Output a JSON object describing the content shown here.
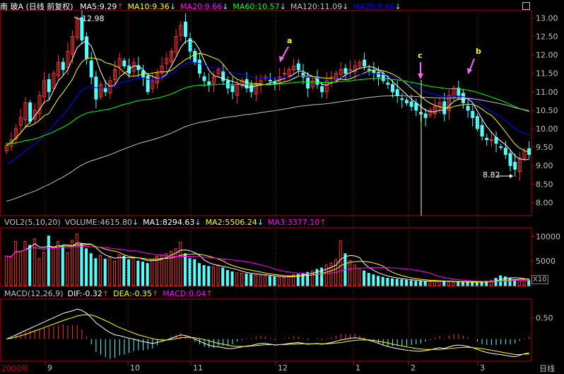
{
  "header": {
    "stock_title": "南 玻A (日线 前复权)",
    "ma_items": [
      {
        "label": "MA5:9.29",
        "color": "#ffffff",
        "arrow": "↑"
      },
      {
        "label": "MA10:9.36",
        "color": "#ffff00",
        "arrow": "↓"
      },
      {
        "label": "MA20:9.66",
        "color": "#ff00ff",
        "arrow": "↓"
      },
      {
        "label": "MA60:10.57",
        "color": "#00ff00",
        "arrow": "↓"
      },
      {
        "label": "MA120:11.09",
        "color": "#c0c0c0",
        "arrow": "↓"
      },
      {
        "label": "MA20:9.66",
        "color": "#0000ff",
        "arrow": "↓"
      }
    ]
  },
  "volume_header": {
    "items": [
      {
        "label": "VOL2(5,10,20)",
        "color": "#c0c0c0",
        "arrow": ""
      },
      {
        "label": "VOLUME:4615.80",
        "color": "#c0c0c0",
        "arrow": "↓"
      },
      {
        "label": "MA1:8294.63",
        "color": "#ffffff",
        "arrow": "↓"
      },
      {
        "label": "MA2:5506.24",
        "color": "#ffff00",
        "arrow": "↓"
      },
      {
        "label": "MA3:3377.10",
        "color": "#ff00ff",
        "arrow": "↑"
      }
    ]
  },
  "macd_header": {
    "items": [
      {
        "label": "MACD(12,26,9)",
        "color": "#c0c0c0",
        "arrow": ""
      },
      {
        "label": "DIF:-0.32",
        "color": "#ffffff",
        "arrow": "↑"
      },
      {
        "label": "DEA:-0.35",
        "color": "#ffff00",
        "arrow": "↑"
      },
      {
        "label": "MACD:0.04",
        "color": "#ff00ff",
        "arrow": "↑"
      }
    ]
  },
  "annotations": {
    "high_label": "12.98",
    "low_label": "8.82",
    "mark_a": "a",
    "mark_b": "b",
    "mark_c": "c",
    "vol_scale": "X10"
  },
  "footer": {
    "year_label": "2000年",
    "period_label": "日线",
    "months": [
      "9",
      "10",
      "11",
      "12",
      "1",
      "2",
      "3"
    ]
  },
  "colors": {
    "up": "#ff3232",
    "down": "#54ffff",
    "axis": "#b00000",
    "ma5": "#ffffff",
    "ma10": "#ffff00",
    "ma20": "#0000ff",
    "ma60": "#00ff00",
    "ma120": "#c0c0c0"
  },
  "chart_data": [
    {
      "type": "candlestick",
      "yticks": [
        8.0,
        8.5,
        9.0,
        9.5,
        10.0,
        10.5,
        11.0,
        11.5,
        12.0,
        12.5,
        13.0
      ],
      "ylim": [
        7.7,
        13.2
      ],
      "close": [
        9.55,
        9.7,
        10.0,
        10.3,
        10.7,
        10.2,
        10.5,
        10.9,
        11.3,
        11.0,
        11.5,
        11.8,
        11.6,
        12.1,
        12.5,
        12.98,
        12.4,
        11.9,
        11.4,
        10.8,
        11.2,
        11.0,
        11.3,
        11.6,
        11.9,
        11.7,
        11.5,
        11.8,
        11.6,
        11.4,
        11.0,
        11.3,
        11.5,
        11.7,
        11.9,
        12.1,
        12.5,
        12.8,
        12.5,
        12.1,
        11.8,
        11.5,
        11.3,
        11.2,
        11.4,
        11.6,
        11.3,
        11.1,
        11.0,
        11.2,
        11.3,
        11.1,
        11.0,
        11.2,
        11.3,
        11.4,
        11.3,
        11.2,
        11.4,
        11.5,
        11.6,
        11.7,
        11.6,
        11.4,
        11.1,
        11.3,
        11.2,
        11.0,
        11.3,
        11.4,
        11.5,
        11.6,
        11.5,
        11.6,
        11.7,
        11.8,
        11.7,
        11.6,
        11.5,
        11.4,
        11.3,
        11.2,
        11.0,
        10.9,
        10.8,
        10.7,
        10.6,
        10.5,
        10.4,
        10.3,
        10.5,
        10.6,
        10.7,
        10.4,
        10.9,
        11.1,
        10.9,
        10.7,
        10.5,
        10.3,
        10.0,
        9.8,
        9.7,
        9.7,
        9.6,
        9.5,
        9.3,
        9.0,
        8.9,
        9.2,
        9.4,
        9.3
      ],
      "high_value": 12.98,
      "low_value": 8.82
    },
    {
      "type": "bar",
      "title": "VOLUME",
      "yticks": [
        5000,
        10000
      ],
      "ylim": [
        0,
        11500
      ],
      "values": [
        6000,
        5800,
        9000,
        7000,
        9000,
        8200,
        9500,
        5500,
        6800,
        10100,
        7500,
        9000,
        8000,
        6700,
        9200,
        10500,
        8500,
        7500,
        6500,
        5500,
        6200,
        5400,
        5800,
        5000,
        6300,
        6000,
        5300,
        5700,
        5000,
        4800,
        4500,
        5400,
        6000,
        6200,
        6500,
        7000,
        7500,
        8800,
        6500,
        5500,
        5300,
        4500,
        4100,
        3900,
        3800,
        4200,
        3600,
        3100,
        2800,
        2600,
        2500,
        2400,
        2300,
        2200,
        2100,
        2000,
        1900,
        1800,
        1600,
        1700,
        2000,
        2200,
        2300,
        2500,
        2700,
        3000,
        3300,
        3600,
        4200,
        4600,
        5300,
        9100,
        6500,
        5100,
        4200,
        3500,
        3000,
        2500,
        2200,
        1900,
        1700,
        1500,
        1400,
        1300,
        1200,
        1100,
        1000,
        900,
        850,
        800,
        900,
        1000,
        900,
        850,
        800,
        700,
        750,
        800,
        700,
        650,
        700,
        750,
        900,
        1100,
        1500,
        2000,
        1800,
        1500,
        1200,
        1300,
        1200,
        1100
      ],
      "scale_label": "X10"
    },
    {
      "type": "line",
      "title": "MACD",
      "yticks": [
        0.5
      ],
      "ylim": [
        -0.5,
        0.9
      ],
      "series": [
        {
          "name": "DIF",
          "values": [
            0.0,
            0.05,
            0.1,
            0.15,
            0.2,
            0.25,
            0.3,
            0.35,
            0.4,
            0.45,
            0.5,
            0.55,
            0.6,
            0.63,
            0.66,
            0.7,
            0.67,
            0.6,
            0.5,
            0.38,
            0.3,
            0.22,
            0.15,
            0.1,
            0.08,
            0.05,
            0.02,
            0.0,
            -0.03,
            -0.06,
            -0.08,
            -0.1,
            -0.08,
            -0.05,
            -0.02,
            0.02,
            0.06,
            0.1,
            0.08,
            0.05,
            0.0,
            -0.05,
            -0.1,
            -0.14,
            -0.17,
            -0.18,
            -0.2,
            -0.22,
            -0.22,
            -0.2,
            -0.18,
            -0.16,
            -0.15,
            -0.12,
            -0.1,
            -0.1,
            -0.12,
            -0.14,
            -0.13,
            -0.12,
            -0.1,
            -0.09,
            -0.08,
            -0.1,
            -0.12,
            -0.11,
            -0.1,
            -0.12,
            -0.1,
            -0.08,
            -0.05,
            -0.02,
            0.0,
            0.02,
            0.03,
            0.02,
            0.0,
            -0.03,
            -0.06,
            -0.1,
            -0.14,
            -0.17,
            -0.2,
            -0.22,
            -0.24,
            -0.26,
            -0.27,
            -0.28,
            -0.28,
            -0.27,
            -0.25,
            -0.22,
            -0.2,
            -0.22,
            -0.18,
            -0.15,
            -0.14,
            -0.15,
            -0.17,
            -0.2,
            -0.24,
            -0.28,
            -0.31,
            -0.33,
            -0.35,
            -0.36,
            -0.38,
            -0.4,
            -0.41,
            -0.38,
            -0.34,
            -0.32
          ]
        },
        {
          "name": "DEA",
          "values": [
            0.0,
            0.02,
            0.05,
            0.08,
            0.11,
            0.15,
            0.19,
            0.23,
            0.27,
            0.31,
            0.35,
            0.39,
            0.43,
            0.47,
            0.5,
            0.54,
            0.56,
            0.57,
            0.56,
            0.53,
            0.48,
            0.43,
            0.38,
            0.32,
            0.27,
            0.23,
            0.18,
            0.14,
            0.1,
            0.07,
            0.04,
            0.01,
            -0.01,
            -0.02,
            -0.02,
            -0.01,
            0.01,
            0.03,
            0.04,
            0.04,
            0.03,
            0.01,
            -0.01,
            -0.04,
            -0.07,
            -0.1,
            -0.12,
            -0.14,
            -0.16,
            -0.17,
            -0.17,
            -0.17,
            -0.16,
            -0.15,
            -0.14,
            -0.13,
            -0.13,
            -0.13,
            -0.13,
            -0.13,
            -0.12,
            -0.12,
            -0.11,
            -0.11,
            -0.11,
            -0.11,
            -0.11,
            -0.11,
            -0.11,
            -0.1,
            -0.09,
            -0.08,
            -0.06,
            -0.04,
            -0.03,
            -0.02,
            -0.02,
            -0.02,
            -0.03,
            -0.05,
            -0.07,
            -0.09,
            -0.12,
            -0.14,
            -0.16,
            -0.18,
            -0.2,
            -0.22,
            -0.23,
            -0.24,
            -0.24,
            -0.24,
            -0.24,
            -0.23,
            -0.22,
            -0.21,
            -0.2,
            -0.19,
            -0.19,
            -0.2,
            -0.21,
            -0.22,
            -0.24,
            -0.26,
            -0.28,
            -0.3,
            -0.32,
            -0.34,
            -0.36,
            -0.36,
            -0.35,
            -0.35
          ]
        }
      ]
    }
  ]
}
